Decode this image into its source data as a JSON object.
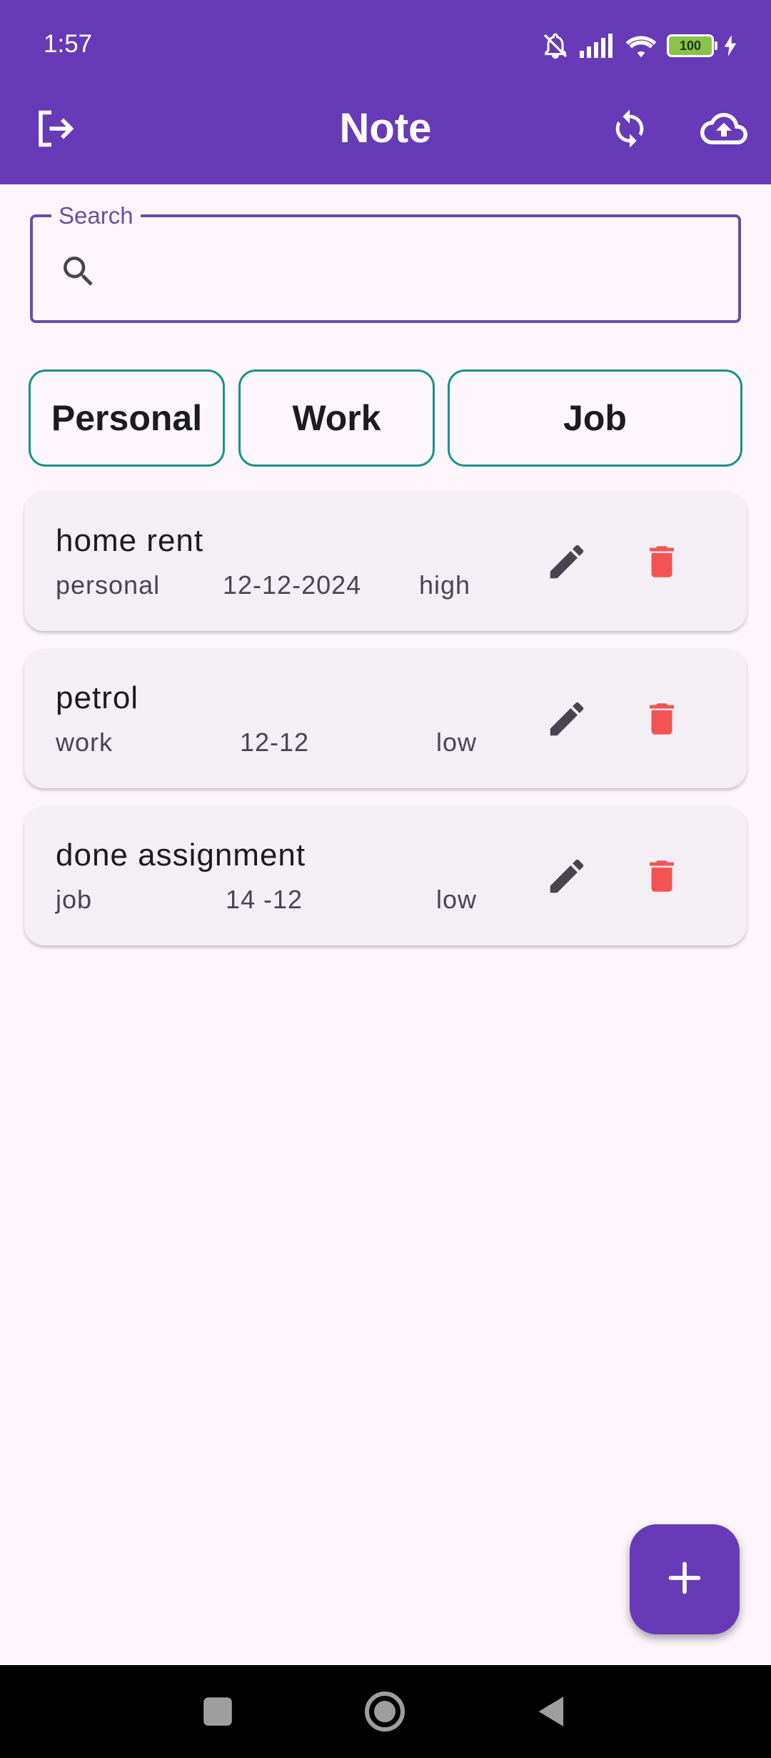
{
  "status_bar": {
    "time": "1:57",
    "battery": "100",
    "icons": [
      "bell-off-icon",
      "signal-icon",
      "wifi-icon",
      "battery-icon",
      "charging-icon"
    ]
  },
  "app_bar": {
    "title": "Note",
    "color": "#673ab7",
    "actions": [
      "logout-icon",
      "sync-icon",
      "cloud-upload-icon"
    ]
  },
  "search": {
    "label": "Search",
    "value": "",
    "placeholder": ""
  },
  "filters": [
    {
      "label": "Personal"
    },
    {
      "label": "Work"
    },
    {
      "label": "Job"
    }
  ],
  "notes": [
    {
      "title": "home rent",
      "category": "personal",
      "date": "12-12-2024",
      "priority": "high"
    },
    {
      "title": "petrol",
      "category": "work",
      "date": "12-12",
      "priority": "low"
    },
    {
      "title": "done assignment",
      "category": "job",
      "date": "14 -12",
      "priority": "low"
    }
  ],
  "fab": {
    "icon": "plus-icon"
  },
  "colors": {
    "accent": "#673ab7",
    "chip_border": "#1a9289",
    "delete": "#f45353",
    "edit": "#49454f"
  },
  "nav": [
    "recent-apps-icon",
    "home-icon",
    "back-icon"
  ]
}
